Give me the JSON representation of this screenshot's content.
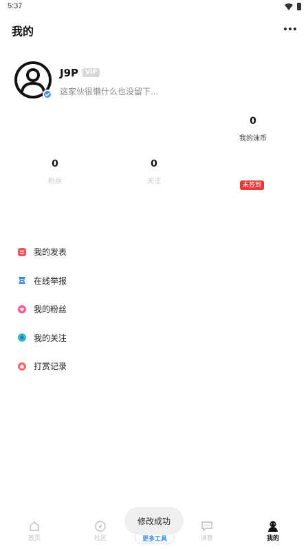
{
  "status_bar": {
    "time": "5:37"
  },
  "header": {
    "title": "我的"
  },
  "profile": {
    "username": "J9P",
    "vip_label": "VIP",
    "signature": "这家伙很懒什么也没留下..."
  },
  "stats": {
    "coins": {
      "value": "0",
      "label": "我的沫币"
    },
    "fans": {
      "value": "0",
      "label": "粉丝"
    },
    "following": {
      "value": "0",
      "label": "关注"
    },
    "sign_in": "未签到"
  },
  "menu": {
    "items": [
      {
        "label": "我的发表",
        "icon": "post-icon",
        "color": "#f25a5a"
      },
      {
        "label": "在线举报",
        "icon": "report-icon",
        "color": "#3f8ee8"
      },
      {
        "label": "我的粉丝",
        "icon": "heart-icon",
        "color": "#ff5d8f"
      },
      {
        "label": "我的关注",
        "icon": "follow-icon",
        "color": "#2bc0b0"
      },
      {
        "label": "打赏记录",
        "icon": "reward-icon",
        "color": "#f26a6a"
      }
    ]
  },
  "tabbar": {
    "home": "首页",
    "community": "社区",
    "tools": "更多工具",
    "messages": "消息",
    "mine": "我的",
    "active": "mine"
  },
  "toast": "修改成功",
  "colors": {
    "accent": "#3a8fe0",
    "badge_red": "#e53935",
    "vip_gray": "#d8d8d8"
  }
}
